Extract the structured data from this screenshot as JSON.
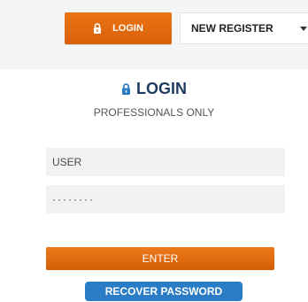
{
  "header": {
    "login_button_label": "LOGIN",
    "register_select_value": "NEW REGISTER"
  },
  "login": {
    "title": "LOGIN",
    "subtitle": "PROFESSIONALS ONLY",
    "user_placeholder": "USER",
    "password_masked": "········",
    "enter_label": "ENTER",
    "recover_label": "RECOVER PASSWORD"
  },
  "icons": {
    "header_lock": "lock-icon",
    "title_lock": "lock-icon",
    "register_caret": "chevron-down-icon"
  },
  "colors": {
    "accent_orange": "#e46a0e",
    "title_navy": "#1e3a5f",
    "recover_blue": "#2a7dc4",
    "field_bg": "#f1f2f4"
  }
}
